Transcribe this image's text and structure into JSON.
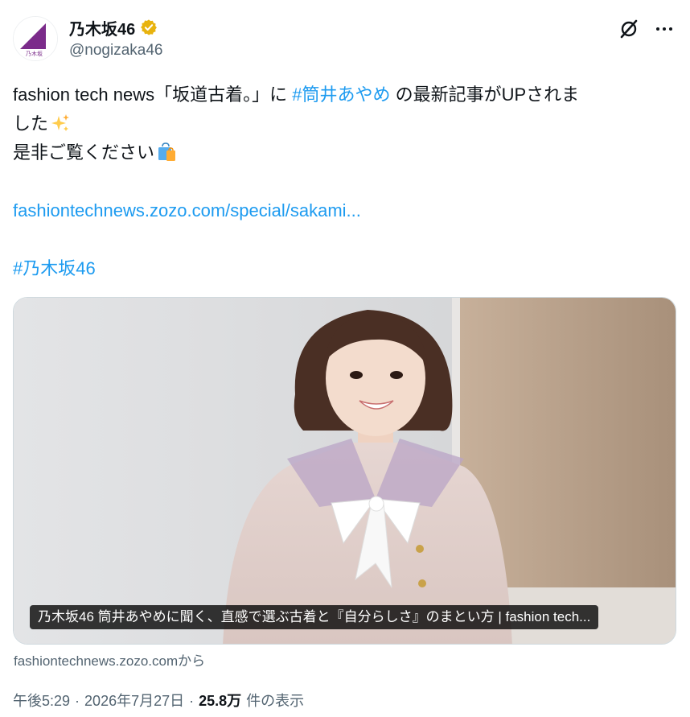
{
  "author": {
    "display_name": "乃木坂46",
    "handle": "@nogizaka46",
    "avatar_icon": "nogizaka-logo-icon",
    "verified_color": "#e8b30e",
    "avatar_color": "#7b2b8a"
  },
  "actions": {
    "grok_icon": "grok-icon",
    "more_icon": "more-options-icon"
  },
  "tweet": {
    "text_prefix": "fashion tech news「坂道古着。」に ",
    "hashtag1": "#筒井あやめ",
    "text_mid": " の最新記事がUPされま",
    "line2": "した",
    "line2_emoji": "sparkles-icon",
    "line3": "是非ご覧ください",
    "line3_emoji": "shopping-bags-icon",
    "link": "fashiontechnews.zozo.com/special/sakami...",
    "hashtag2": "#乃木坂46"
  },
  "card": {
    "caption": "乃木坂46 筒井あやめに聞く、直感で選ぶ古着と『自分らしさ』のまとい方 | fashion tech...",
    "source": "fashiontechnews.zozo.comから"
  },
  "meta": {
    "time": "午後5:29",
    "separator": "·",
    "date": "2026年7月27日",
    "views_count": "25.8万",
    "views_label": "件の表示"
  },
  "colors": {
    "link": "#1d9bf0",
    "text": "#0f1419",
    "secondary": "#536471"
  }
}
